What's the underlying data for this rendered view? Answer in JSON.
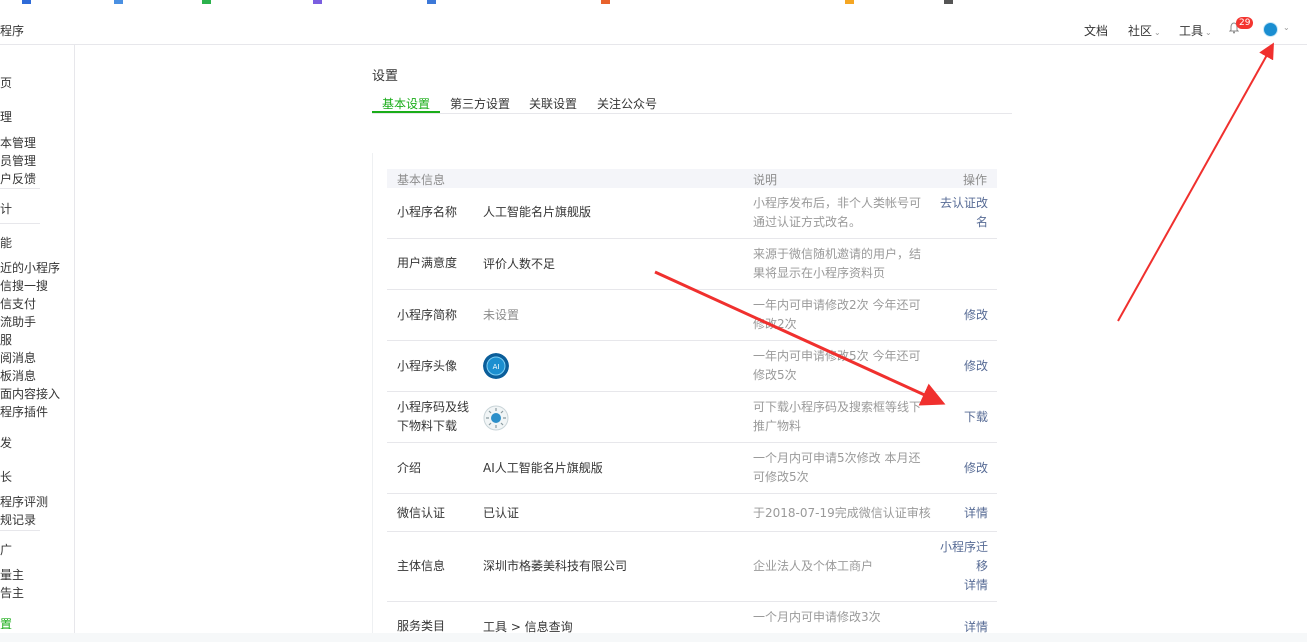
{
  "topbar": {
    "brand": "程序",
    "nav": [
      {
        "label": "文档",
        "caret": ""
      },
      {
        "label": "社区",
        "caret": "⌄"
      },
      {
        "label": "工具",
        "caret": "⌄"
      }
    ],
    "badge": "29",
    "avatar_caret": "⌄"
  },
  "sidebar": {
    "items": [
      {
        "label": "页"
      },
      {
        "label": "理"
      },
      {
        "label": "本管理"
      },
      {
        "label": "员管理"
      },
      {
        "label": "户反馈"
      },
      {
        "label": "计"
      },
      {
        "label": "能"
      },
      {
        "label": "近的小程序"
      },
      {
        "label": "信搜一搜"
      },
      {
        "label": "信支付"
      },
      {
        "label": "流助手"
      },
      {
        "label": "服"
      },
      {
        "label": "阅消息"
      },
      {
        "label": "板消息"
      },
      {
        "label": "面内容接入"
      },
      {
        "label": "程序插件"
      },
      {
        "label": "发"
      },
      {
        "label": "长"
      },
      {
        "label": "程序评测"
      },
      {
        "label": "规记录"
      },
      {
        "label": "广"
      },
      {
        "label": "量主"
      },
      {
        "label": "告主"
      },
      {
        "label": "置"
      }
    ]
  },
  "main": {
    "title": "设置",
    "tabs": [
      {
        "label": "基本设置"
      },
      {
        "label": "第三方设置"
      },
      {
        "label": "关联设置"
      },
      {
        "label": "关注公众号"
      }
    ],
    "table": {
      "headers": {
        "info": "基本信息",
        "desc": "说明",
        "op": "操作"
      },
      "rows": [
        {
          "label": "小程序名称",
          "value": "人工智能名片旗舰版",
          "desc": "小程序发布后，非个人类帐号可通过认证方式改名。",
          "op": "去认证改名"
        },
        {
          "label": "用户满意度",
          "value": "评价人数不足",
          "desc": "来源于微信随机邀请的用户，结果将显示在小程序资料页",
          "op": ""
        },
        {
          "label": "小程序简称",
          "value": "未设置",
          "desc": "一年内可申请修改2次 今年还可修改2次",
          "op": "修改"
        },
        {
          "label": "小程序头像",
          "value": "",
          "desc": "一年内可申请修改5次 今年还可修改5次",
          "op": "修改"
        },
        {
          "label": "小程序码及线下物料下载",
          "value": "",
          "desc": "可下载小程序码及搜索框等线下推广物料",
          "op": "下载"
        },
        {
          "label": "介绍",
          "value": "AI人工智能名片旗舰版",
          "desc": "一个月内可申请5次修改 本月还可修改5次",
          "op": "修改"
        },
        {
          "label": "微信认证",
          "value": "已认证",
          "desc": "于2018-07-19完成微信认证审核",
          "op": "详情"
        },
        {
          "label": "主体信息",
          "value": "深圳市格萎美科技有限公司",
          "desc": "企业法人及个体工商户",
          "op": "小程序迁移",
          "op2": "详情"
        },
        {
          "label": "服务类目",
          "value": "工具 > 信息查询",
          "desc": "一个月内可申请修改3次",
          "op": "详情"
        }
      ]
    }
  },
  "colors": {
    "accent": "#1aad19",
    "link": "#576b95",
    "annotation": "#f0302e"
  }
}
